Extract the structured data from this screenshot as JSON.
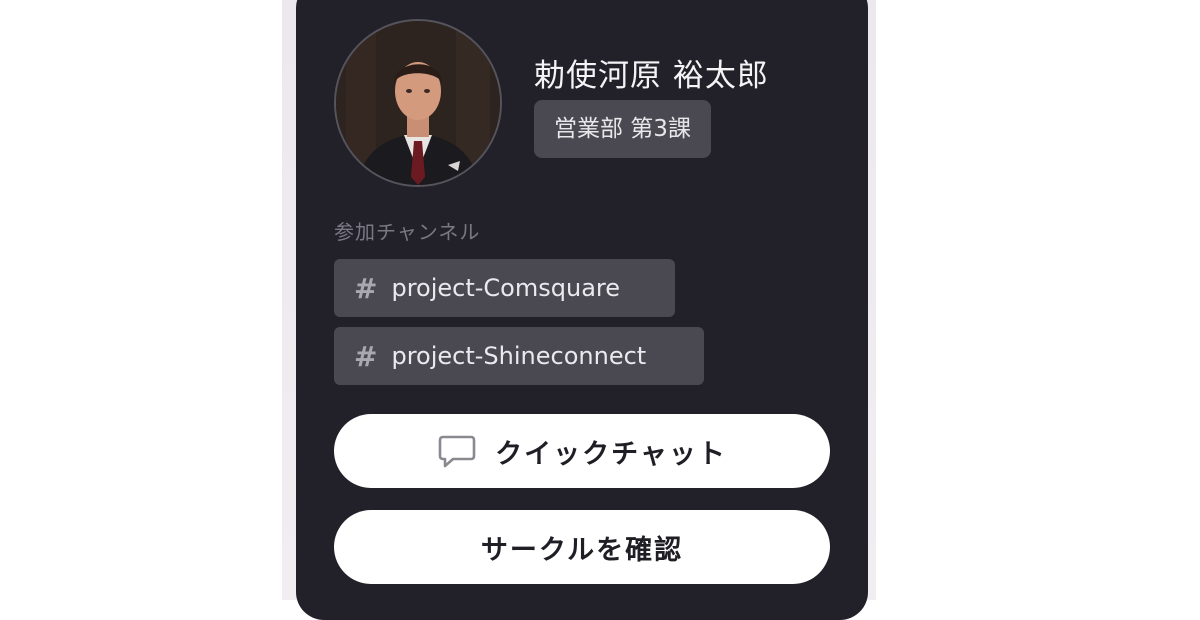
{
  "profile": {
    "name": "勅使河原 裕太郎",
    "department": "営業部 第3課"
  },
  "channels": {
    "section_label": "参加チャンネル",
    "items": [
      {
        "icon": "hash-icon",
        "hash": "#",
        "label": "project-Comsquare"
      },
      {
        "icon": "hash-icon",
        "hash": "#",
        "label": "project-Shineconnect"
      }
    ]
  },
  "actions": {
    "quick_chat_label": "クイックチャット",
    "quick_chat_icon": "chat-bubble-icon",
    "check_circle_label": "サークルを確認"
  },
  "colors": {
    "card_background": "#22212a",
    "badge_background": "#4a4951",
    "button_background": "#ffffff"
  }
}
